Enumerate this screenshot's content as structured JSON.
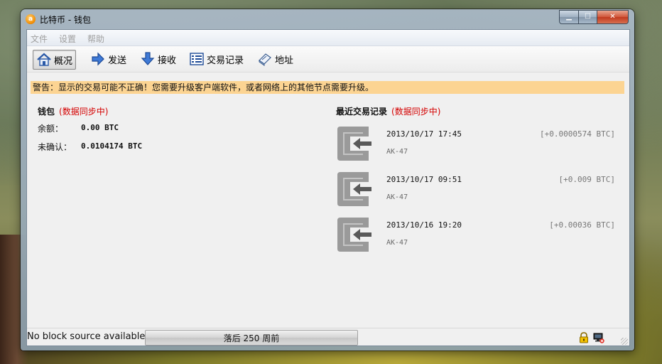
{
  "window": {
    "title": "比特币 - 钱包",
    "app_icon_letter": "a"
  },
  "menubar": {
    "items": [
      "文件",
      "设置",
      "帮助"
    ]
  },
  "toolbar": {
    "items": [
      {
        "label": "概况",
        "icon": "home-icon",
        "active": true
      },
      {
        "label": "发送",
        "icon": "send-arrow-icon",
        "active": false
      },
      {
        "label": "接收",
        "icon": "receive-arrow-icon",
        "active": false
      },
      {
        "label": "交易记录",
        "icon": "transactions-list-icon",
        "active": false
      },
      {
        "label": "地址",
        "icon": "address-book-icon",
        "active": false
      }
    ]
  },
  "warning": "警告：显示的交易可能不正确！您需要升级客户端软件，或者网络上的其他节点需要升级。",
  "wallet": {
    "title": "钱包",
    "sync_status": "(数据同步中)",
    "balance_label": "余额：",
    "balance_value": "0.00 BTC",
    "unconfirmed_label": "未确认：",
    "unconfirmed_value": "0.0104174 BTC"
  },
  "recent": {
    "title": "最近交易记录",
    "sync_status": "(数据同步中)",
    "transactions": [
      {
        "date": "2013/10/17 17:45",
        "amount": "[+0.0000574 BTC]",
        "address": "AK-47"
      },
      {
        "date": "2013/10/17 09:51",
        "amount": "[+0.009 BTC]",
        "address": "AK-47"
      },
      {
        "date": "2013/10/16 19:20",
        "amount": "[+0.00036 BTC]",
        "address": "AK-47"
      }
    ]
  },
  "status": {
    "source_text": "No block source available...",
    "progress_text": "落后 250 周前"
  },
  "colors": {
    "warning_bg": "#fcd492",
    "sync_red": "#d40000",
    "client_bg": "#f0f0f0"
  }
}
